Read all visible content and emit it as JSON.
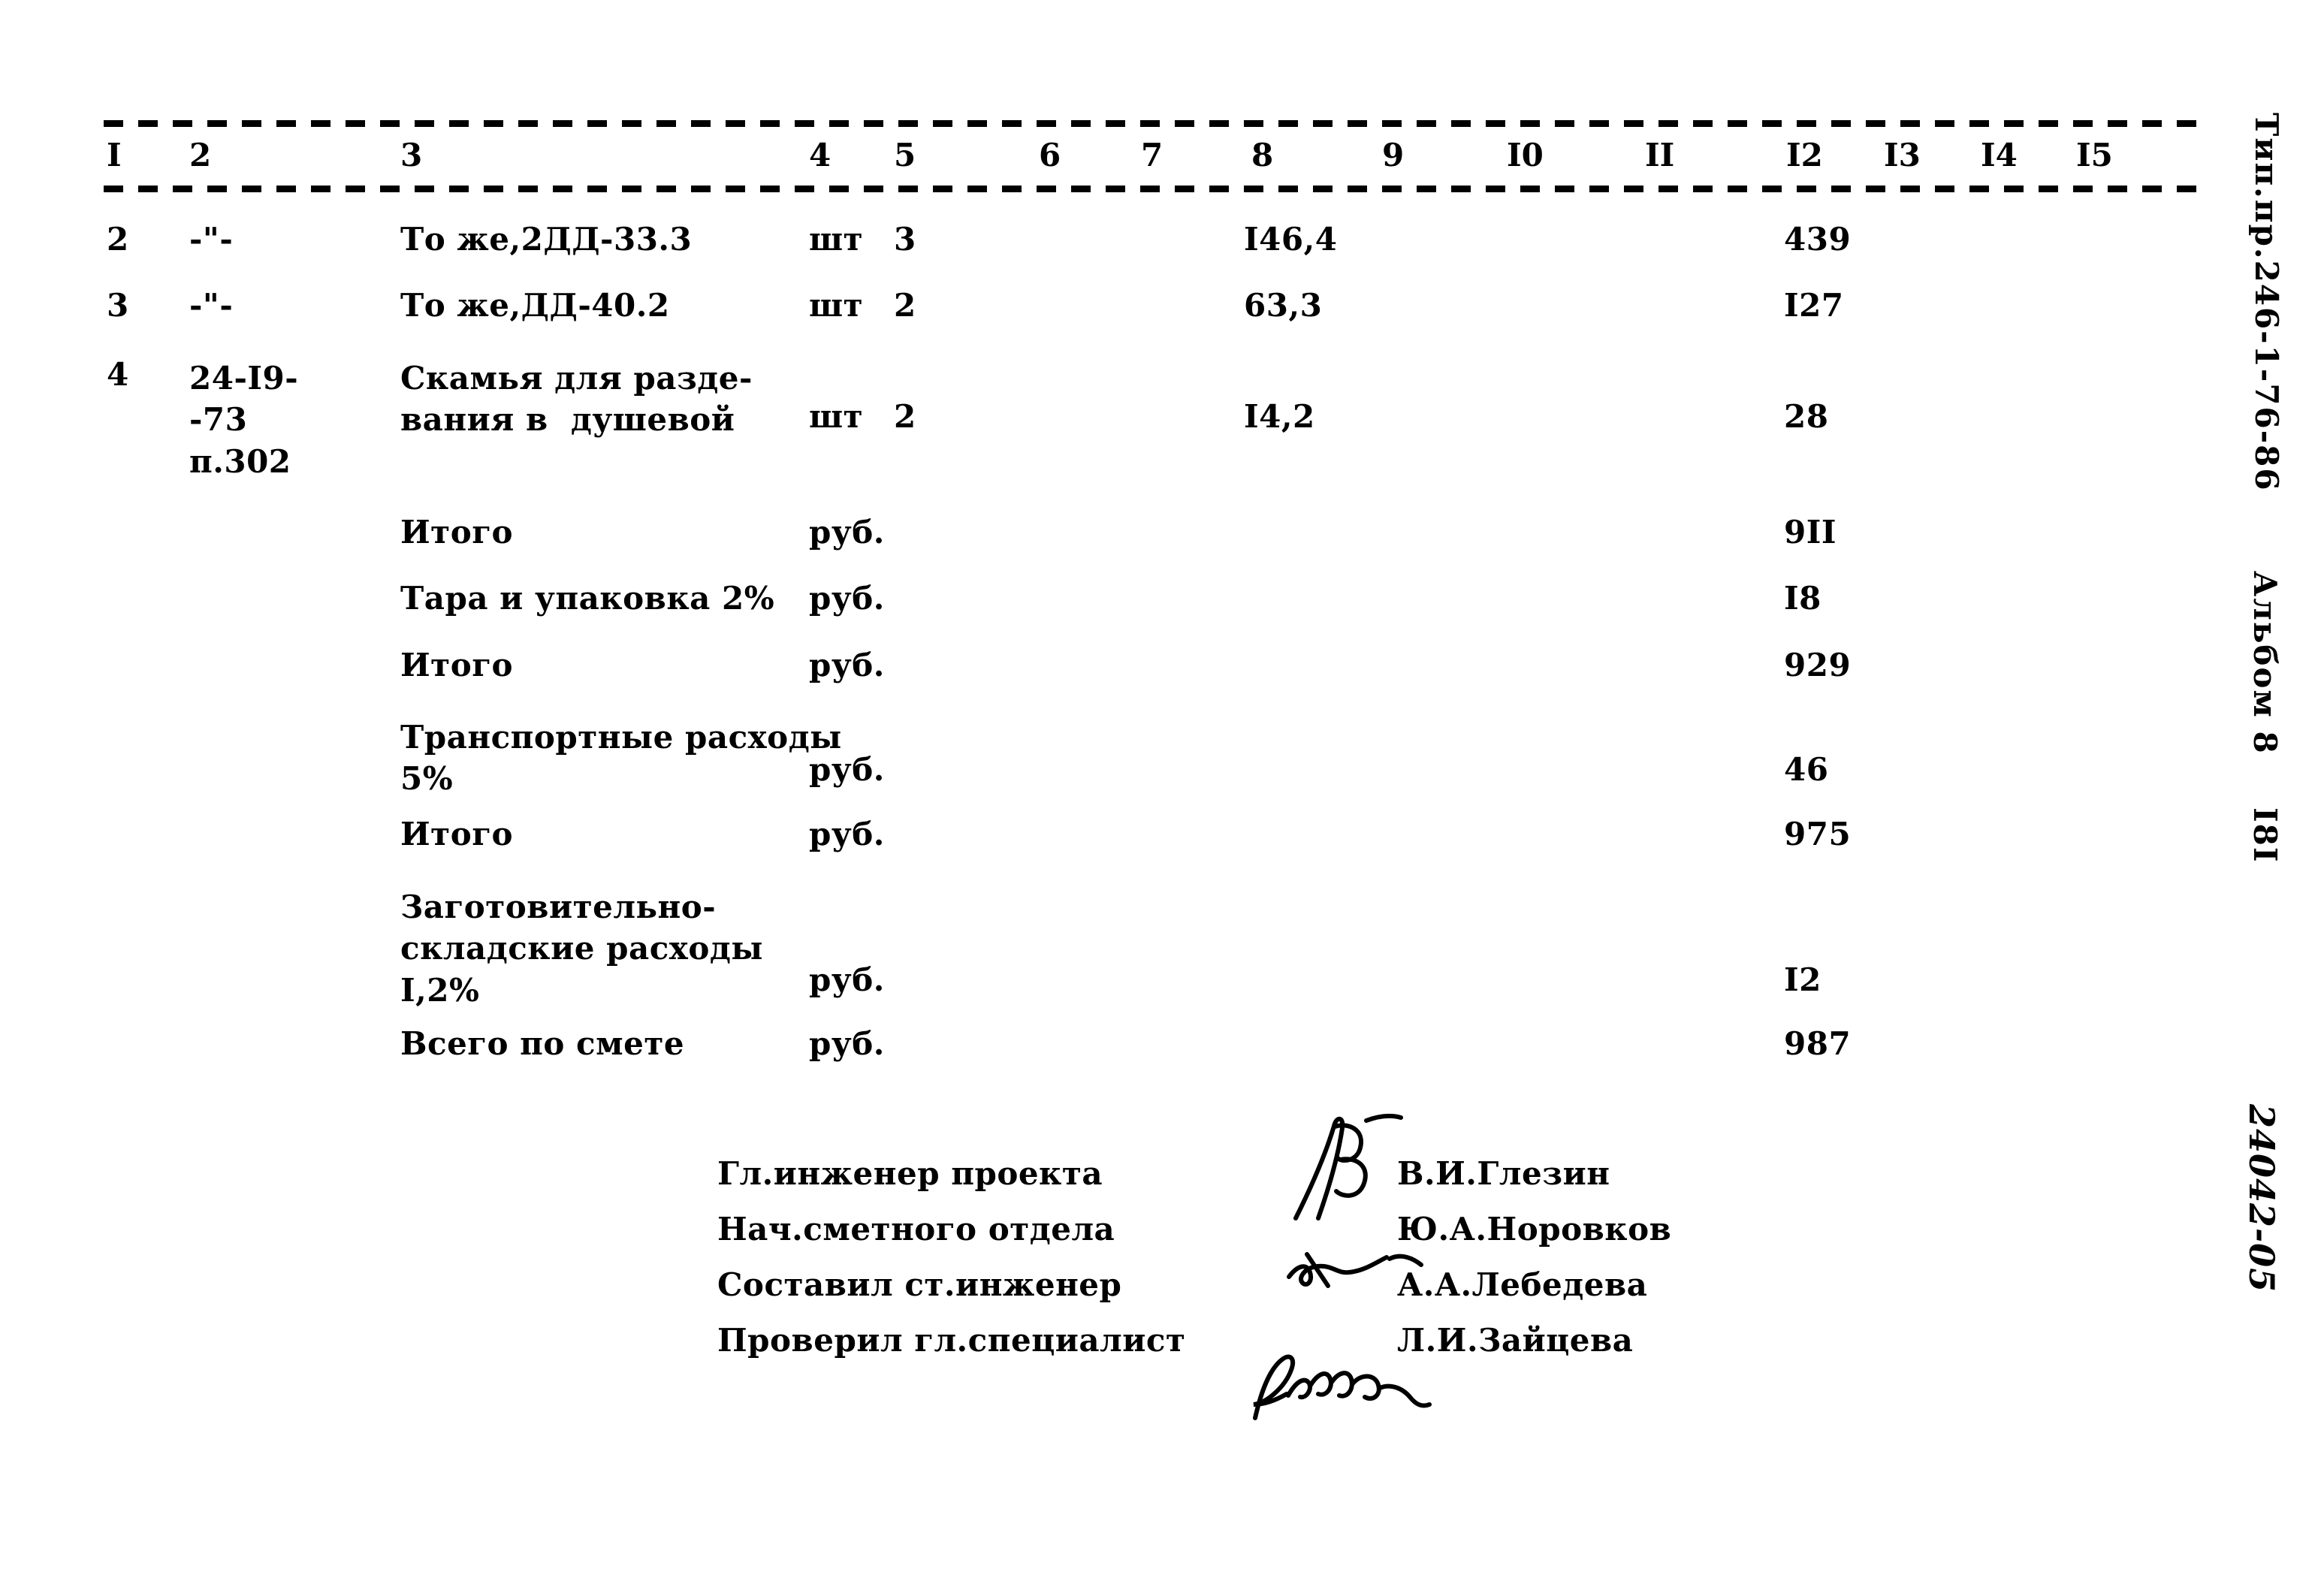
{
  "document": {
    "type": "smeta-table",
    "ink_color": "#000000",
    "paper_color": "#ffffff"
  },
  "table": {
    "column_headers": [
      "I",
      "2",
      "3",
      "4",
      "5",
      "6",
      "7",
      "8",
      "9",
      "I0",
      "II",
      "I2",
      "I3",
      "I4",
      "I5"
    ],
    "rows": [
      {
        "no": "2",
        "code": "-\"-",
        "name": "То же,2ДД-33.3",
        "unit": "шт",
        "qty": "3",
        "price": "I46,4",
        "total": "439"
      },
      {
        "no": "3",
        "code": "-\"-",
        "name": "То же,ДД-40.2",
        "unit": "шт",
        "qty": "2",
        "price": "63,3",
        "total": "I27"
      },
      {
        "no": "4",
        "code": "24-I9-\n-73\nп.302",
        "name": "Скамья для разде-\nвания в  душевой",
        "unit": "шт",
        "qty": "2",
        "price": "I4,2",
        "total": "28"
      }
    ],
    "summary_rows": [
      {
        "name": "Итого",
        "unit": "руб.",
        "total": "9II"
      },
      {
        "name": "Тара и упаковка 2%",
        "unit": "руб.",
        "total": "I8"
      },
      {
        "name": "Итого",
        "unit": "руб.",
        "total": "929"
      },
      {
        "name": "Транспортные расходы\n5%",
        "unit": "руб.",
        "total": "46"
      },
      {
        "name": "Итого",
        "unit": "руб.",
        "total": "975"
      },
      {
        "name": "Заготовительно-\nскладские расходы\nI,2%",
        "unit": "руб.",
        "total": "I2"
      },
      {
        "name": "Всего по смете",
        "unit": "руб.",
        "total": "987"
      }
    ]
  },
  "signatures": [
    {
      "title": "Гл.инженер проекта",
      "name": "В.И.Глезин",
      "has_mark": true
    },
    {
      "title": "Нач.сметного отдела",
      "name": "Ю.А.Норовков",
      "has_mark": true
    },
    {
      "title": "Составил ст.инженер",
      "name": "А.А.Лебедева",
      "has_mark": true
    },
    {
      "title": "Проверил гл.специалист",
      "name": "Л.И.Зайцева",
      "has_mark": false
    }
  ],
  "margin_stamps": {
    "doc_code": "Тип.пр.246-1-76-86",
    "album": "Альбом 8",
    "page": "I8I",
    "handwritten": "24042-05"
  }
}
